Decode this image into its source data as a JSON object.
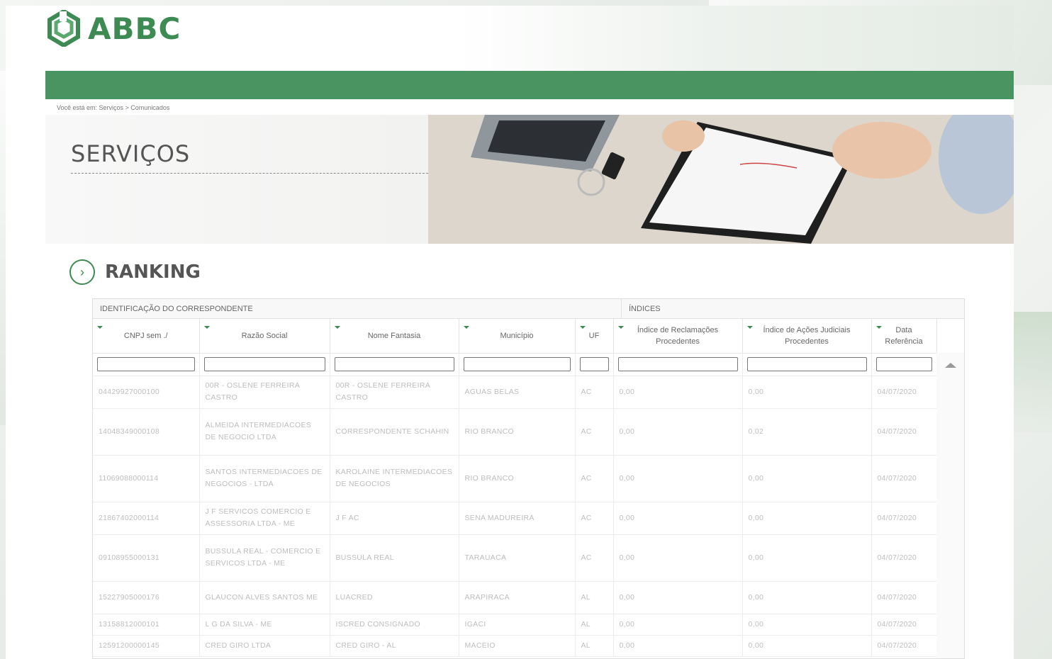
{
  "header": {
    "logo_text": "ABBC"
  },
  "breadcrumb": "Você está em: Serviços > Comunicados",
  "hero": {
    "title": "SERVIÇOS"
  },
  "ranking": {
    "title": "RANKING"
  },
  "table": {
    "groups": [
      "IDENTIFICAÇÃO DO CORRESPONDENTE",
      "ÍNDICES"
    ],
    "columns": [
      "CNPJ sem ./",
      "Razão Social",
      "Nome Fantasia",
      "Município",
      "UF",
      "Índice de Reclamações Procedentes",
      "Índice de Ações Judiciais Procedentes",
      "Data Referência"
    ],
    "rows": [
      [
        "04429927000100",
        "00R - OSLENE FERREIRA CASTRO",
        "00R - OSLENE FERREIRA CASTRO",
        "AGUAS BELAS",
        "AC",
        "0,00",
        "0,00",
        "04/07/2020"
      ],
      [
        "14048349000108",
        "ALMEIDA INTERMEDIACOES DE NEGOCIO LTDA",
        "CORRESPONDENTE SCHAHIN",
        "RIO BRANCO",
        "AC",
        "0,00",
        "0,02",
        "04/07/2020"
      ],
      [
        "11069088000114",
        "SANTOS INTERMEDIACOES DE NEGOCIOS - LTDA",
        "KAROLAINE INTERMEDIACOES DE NEGOCIOS",
        "RIO BRANCO",
        "AC",
        "0,00",
        "0,00",
        "04/07/2020"
      ],
      [
        "21867402000114",
        "J F SERVICOS COMERCIO E ASSESSORIA LTDA - ME",
        "J F AC",
        "SENA MADUREIRA",
        "AC",
        "0,00",
        "0,00",
        "04/07/2020"
      ],
      [
        "09108955000131",
        "BUSSULA REAL - COMERCIO E SERVICOS LTDA - ME",
        "BUSSULA REAL",
        "TARAUACA",
        "AC",
        "0,00",
        "0,00",
        "04/07/2020"
      ],
      [
        "15227905000176",
        "GLAUCON ALVES SANTOS ME",
        "LUACRED",
        "ARAPIRACA",
        "AL",
        "0,00",
        "0,00",
        "04/07/2020"
      ],
      [
        "13158812000101",
        "L G DA SILVA - ME",
        "ISCRED CONSIGNADO",
        "IGACI",
        "AL",
        "0,00",
        "0,00",
        "04/07/2020"
      ],
      [
        "12591200000145",
        "CRED GIRO LTDA",
        "CRED GIRO - AL",
        "MACEIO",
        "AL",
        "0,00",
        "0,00",
        "04/07/2020"
      ]
    ]
  },
  "colors": {
    "brand_green": "#4a9461",
    "logo_green": "#3d8a52"
  }
}
